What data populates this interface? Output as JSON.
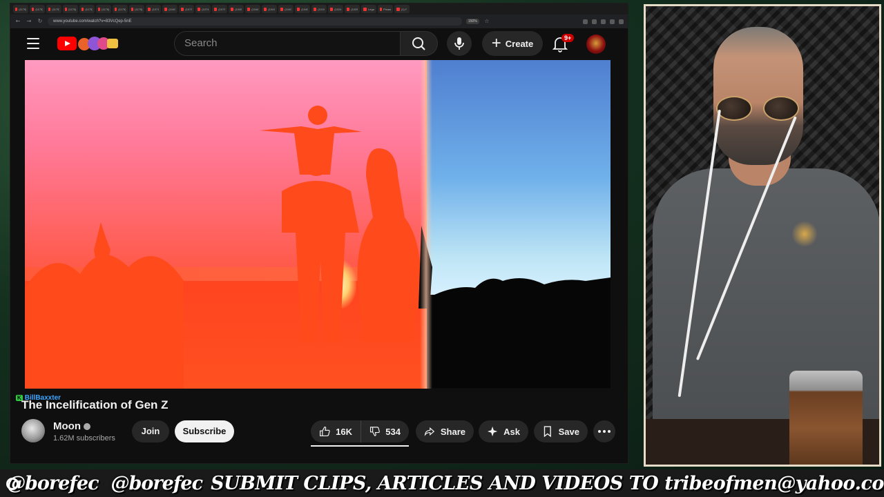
{
  "browser": {
    "url": "www.youtube.com/watch?v=83VcQep-5nE",
    "zoom": "150%",
    "tabs": [
      "(1175) Wi",
      "(1175) Hi",
      "(1175) G",
      "(1175) Toc",
      "(1175) Hi",
      "(1175) El !",
      "(1175) Th",
      "(1175) Wh",
      "(1071)",
      "(1040)",
      "(1073)",
      "(1074)",
      "(1073)",
      "(1045)",
      "(1044)",
      "(1041)",
      "(1040)",
      "(1040)",
      "(1019)",
      "(1024)",
      "(1025)",
      "Lega",
      "Please Sh",
      "(1) F"
    ]
  },
  "youtube": {
    "search_placeholder": "Search",
    "create_label": "Create",
    "notifications_badge": "9+",
    "video": {
      "title": "The Incelification of Gen Z",
      "channel": "Moon",
      "subscribers": "1.62M subscribers",
      "join_label": "Join",
      "subscribe_label": "Subscribe",
      "likes": "16K",
      "dislikes": "534",
      "share_label": "Share",
      "ask_label": "Ask",
      "save_label": "Save"
    },
    "chat_user": "BillBaxxter",
    "chat_badge": "K"
  },
  "banner": {
    "instagram_handle": "@borefec",
    "twitter_handle": "@borefec",
    "message": "SUBMIT CLIPS, ARTICLES AND VIDEOS TO tribeofmen@yahoo.com"
  },
  "colors": {
    "yt_red": "#ff0000",
    "accent_blue": "#3ea6ff",
    "frame_border": "#e6dcc8"
  }
}
